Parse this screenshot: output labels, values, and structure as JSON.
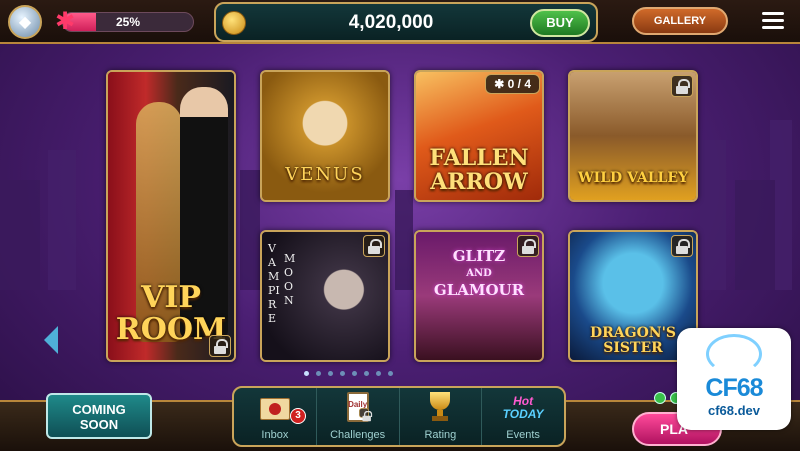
{
  "header": {
    "progress_label": "25%",
    "progress_fraction": 0.25,
    "coins": "4,020,000",
    "buy_label": "BUY",
    "gallery_label": "GALLERY",
    "icons": [
      "diamond-icon",
      "puzzle-icon",
      "coin-icon",
      "menu-icon"
    ]
  },
  "games": [
    {
      "id": "vip-room",
      "line1": "VIP",
      "line2": "ROOM",
      "locked": true
    },
    {
      "id": "venus",
      "title": "VENUS",
      "locked": false
    },
    {
      "id": "fallen-arrow",
      "line1": "FALLEN",
      "line2": "ARROW",
      "pieces": "0 / 4",
      "locked": false
    },
    {
      "id": "wild-valley",
      "title": "WILD VALLEY",
      "locked": true
    },
    {
      "id": "vampire-moon",
      "vertical1": "VAMPIRE",
      "vertical2": "MOON",
      "locked": true
    },
    {
      "id": "glitz-and-glamour",
      "line1": "GLITZ",
      "line2": "AND",
      "line3": "GLAMOUR",
      "locked": true
    },
    {
      "id": "dragons-sister",
      "line1": "DRAGON'S",
      "line2": "SISTER",
      "locked": true
    }
  ],
  "pagination": {
    "count": 8,
    "active": 0
  },
  "bottom": {
    "coming_soon_line1": "COMING",
    "coming_soon_line2": "SOON",
    "nav": [
      {
        "label": "Inbox",
        "badge": "3"
      },
      {
        "label": "Challenges",
        "icon_text": "Daily"
      },
      {
        "label": "Rating"
      },
      {
        "label": "Events",
        "icon_line1": "Hot",
        "icon_line2": "TODAY"
      }
    ],
    "play_label": "PLA"
  },
  "watermark": {
    "name": "CF68",
    "url": "cf68.dev"
  },
  "colors": {
    "gold": "#c9a45a",
    "title_gold": "#ffd45a",
    "buy_green": "#3aa03a",
    "gallery_orange": "#c0602a",
    "play_pink": "#e02a7a",
    "teal": "#1f8a8a"
  }
}
